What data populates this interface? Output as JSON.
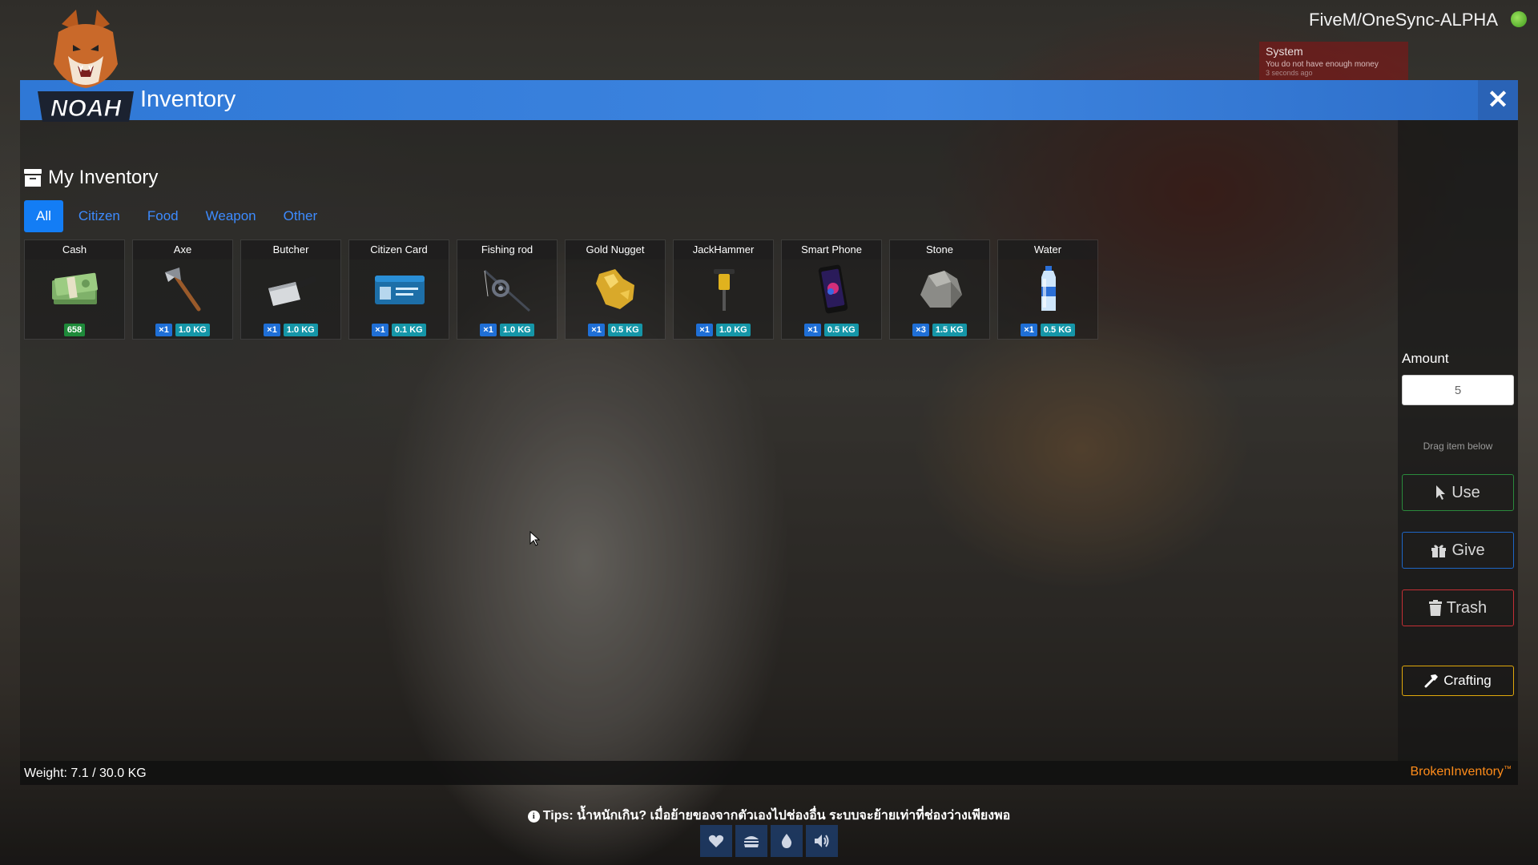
{
  "server": {
    "label": "FiveM/OneSync-ALPHA",
    "icon": "lime-icon"
  },
  "notification": {
    "title": "System",
    "message": "You do not have enough money",
    "age": "3 seconds ago"
  },
  "window": {
    "title": "Inventory",
    "close_icon": "close-icon",
    "logo_text": "NOAH"
  },
  "inventory": {
    "heading": "My Inventory",
    "tabs": [
      {
        "label": "All",
        "active": true
      },
      {
        "label": "Citizen",
        "active": false
      },
      {
        "label": "Food",
        "active": false
      },
      {
        "label": "Weapon",
        "active": false
      },
      {
        "label": "Other",
        "active": false
      }
    ],
    "items": [
      {
        "name": "Cash",
        "icon": "cash-icon",
        "amount": "658"
      },
      {
        "name": "Axe",
        "icon": "axe-icon",
        "qty": "×1",
        "weight": "1.0 KG"
      },
      {
        "name": "Butcher",
        "icon": "cleaver-icon",
        "qty": "×1",
        "weight": "1.0 KG"
      },
      {
        "name": "Citizen Card",
        "icon": "id-card-icon",
        "qty": "×1",
        "weight": "0.1 KG"
      },
      {
        "name": "Fishing rod",
        "icon": "fishing-rod-icon",
        "qty": "×1",
        "weight": "1.0 KG"
      },
      {
        "name": "Gold Nugget",
        "icon": "gold-nugget-icon",
        "qty": "×1",
        "weight": "0.5 KG"
      },
      {
        "name": "JackHammer",
        "icon": "jackhammer-icon",
        "qty": "×1",
        "weight": "1.0 KG"
      },
      {
        "name": "Smart Phone",
        "icon": "smartphone-icon",
        "qty": "×1",
        "weight": "0.5 KG"
      },
      {
        "name": "Stone",
        "icon": "stone-icon",
        "qty": "×3",
        "weight": "1.5 KG"
      },
      {
        "name": "Water",
        "icon": "water-bottle-icon",
        "qty": "×1",
        "weight": "0.5 KG"
      }
    ],
    "weight_text": "Weight: 7.1 / 30.0 KG"
  },
  "actions": {
    "amount_label": "Amount",
    "amount_value": "5",
    "drag_hint": "Drag item below",
    "use_label": "Use",
    "give_label": "Give",
    "trash_label": "Trash",
    "crafting_label": "Crafting"
  },
  "brand": {
    "text": "BrokenInventory",
    "symbol": "™",
    "color": "#ff8c1a"
  },
  "tips": {
    "text": "Tips: น้ำหนักเกิน? เมื่อย้ายของจากตัวเองไปช่องอื่น ระบบจะย้ายเท่าที่ช่องว่างเพียงพอ"
  },
  "hud": [
    "heart-icon",
    "burger-icon",
    "water-drop-icon",
    "speaker-icon"
  ],
  "colors": {
    "title_bar": "#3e85e0",
    "tab_active": "#137df5",
    "use": "#2a8a3c",
    "give": "#1e66c6",
    "trash": "#c42f35",
    "crafting": "#e0a80b"
  }
}
